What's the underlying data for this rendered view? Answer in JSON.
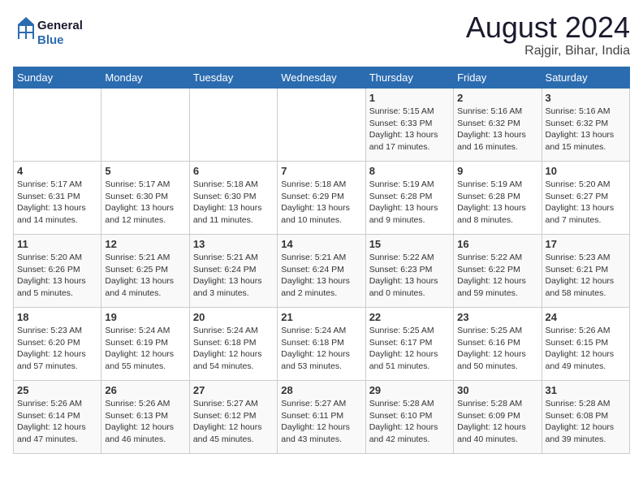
{
  "header": {
    "logo_line1": "General",
    "logo_line2": "Blue",
    "month_year": "August 2024",
    "location": "Rajgir, Bihar, India"
  },
  "days_of_week": [
    "Sunday",
    "Monday",
    "Tuesday",
    "Wednesday",
    "Thursday",
    "Friday",
    "Saturday"
  ],
  "weeks": [
    [
      {
        "day": "",
        "info": ""
      },
      {
        "day": "",
        "info": ""
      },
      {
        "day": "",
        "info": ""
      },
      {
        "day": "",
        "info": ""
      },
      {
        "day": "1",
        "info": "Sunrise: 5:15 AM\nSunset: 6:33 PM\nDaylight: 13 hours\nand 17 minutes."
      },
      {
        "day": "2",
        "info": "Sunrise: 5:16 AM\nSunset: 6:32 PM\nDaylight: 13 hours\nand 16 minutes."
      },
      {
        "day": "3",
        "info": "Sunrise: 5:16 AM\nSunset: 6:32 PM\nDaylight: 13 hours\nand 15 minutes."
      }
    ],
    [
      {
        "day": "4",
        "info": "Sunrise: 5:17 AM\nSunset: 6:31 PM\nDaylight: 13 hours\nand 14 minutes."
      },
      {
        "day": "5",
        "info": "Sunrise: 5:17 AM\nSunset: 6:30 PM\nDaylight: 13 hours\nand 12 minutes."
      },
      {
        "day": "6",
        "info": "Sunrise: 5:18 AM\nSunset: 6:30 PM\nDaylight: 13 hours\nand 11 minutes."
      },
      {
        "day": "7",
        "info": "Sunrise: 5:18 AM\nSunset: 6:29 PM\nDaylight: 13 hours\nand 10 minutes."
      },
      {
        "day": "8",
        "info": "Sunrise: 5:19 AM\nSunset: 6:28 PM\nDaylight: 13 hours\nand 9 minutes."
      },
      {
        "day": "9",
        "info": "Sunrise: 5:19 AM\nSunset: 6:28 PM\nDaylight: 13 hours\nand 8 minutes."
      },
      {
        "day": "10",
        "info": "Sunrise: 5:20 AM\nSunset: 6:27 PM\nDaylight: 13 hours\nand 7 minutes."
      }
    ],
    [
      {
        "day": "11",
        "info": "Sunrise: 5:20 AM\nSunset: 6:26 PM\nDaylight: 13 hours\nand 5 minutes."
      },
      {
        "day": "12",
        "info": "Sunrise: 5:21 AM\nSunset: 6:25 PM\nDaylight: 13 hours\nand 4 minutes."
      },
      {
        "day": "13",
        "info": "Sunrise: 5:21 AM\nSunset: 6:24 PM\nDaylight: 13 hours\nand 3 minutes."
      },
      {
        "day": "14",
        "info": "Sunrise: 5:21 AM\nSunset: 6:24 PM\nDaylight: 13 hours\nand 2 minutes."
      },
      {
        "day": "15",
        "info": "Sunrise: 5:22 AM\nSunset: 6:23 PM\nDaylight: 13 hours\nand 0 minutes."
      },
      {
        "day": "16",
        "info": "Sunrise: 5:22 AM\nSunset: 6:22 PM\nDaylight: 12 hours\nand 59 minutes."
      },
      {
        "day": "17",
        "info": "Sunrise: 5:23 AM\nSunset: 6:21 PM\nDaylight: 12 hours\nand 58 minutes."
      }
    ],
    [
      {
        "day": "18",
        "info": "Sunrise: 5:23 AM\nSunset: 6:20 PM\nDaylight: 12 hours\nand 57 minutes."
      },
      {
        "day": "19",
        "info": "Sunrise: 5:24 AM\nSunset: 6:19 PM\nDaylight: 12 hours\nand 55 minutes."
      },
      {
        "day": "20",
        "info": "Sunrise: 5:24 AM\nSunset: 6:18 PM\nDaylight: 12 hours\nand 54 minutes."
      },
      {
        "day": "21",
        "info": "Sunrise: 5:24 AM\nSunset: 6:18 PM\nDaylight: 12 hours\nand 53 minutes."
      },
      {
        "day": "22",
        "info": "Sunrise: 5:25 AM\nSunset: 6:17 PM\nDaylight: 12 hours\nand 51 minutes."
      },
      {
        "day": "23",
        "info": "Sunrise: 5:25 AM\nSunset: 6:16 PM\nDaylight: 12 hours\nand 50 minutes."
      },
      {
        "day": "24",
        "info": "Sunrise: 5:26 AM\nSunset: 6:15 PM\nDaylight: 12 hours\nand 49 minutes."
      }
    ],
    [
      {
        "day": "25",
        "info": "Sunrise: 5:26 AM\nSunset: 6:14 PM\nDaylight: 12 hours\nand 47 minutes."
      },
      {
        "day": "26",
        "info": "Sunrise: 5:26 AM\nSunset: 6:13 PM\nDaylight: 12 hours\nand 46 minutes."
      },
      {
        "day": "27",
        "info": "Sunrise: 5:27 AM\nSunset: 6:12 PM\nDaylight: 12 hours\nand 45 minutes."
      },
      {
        "day": "28",
        "info": "Sunrise: 5:27 AM\nSunset: 6:11 PM\nDaylight: 12 hours\nand 43 minutes."
      },
      {
        "day": "29",
        "info": "Sunrise: 5:28 AM\nSunset: 6:10 PM\nDaylight: 12 hours\nand 42 minutes."
      },
      {
        "day": "30",
        "info": "Sunrise: 5:28 AM\nSunset: 6:09 PM\nDaylight: 12 hours\nand 40 minutes."
      },
      {
        "day": "31",
        "info": "Sunrise: 5:28 AM\nSunset: 6:08 PM\nDaylight: 12 hours\nand 39 minutes."
      }
    ]
  ]
}
